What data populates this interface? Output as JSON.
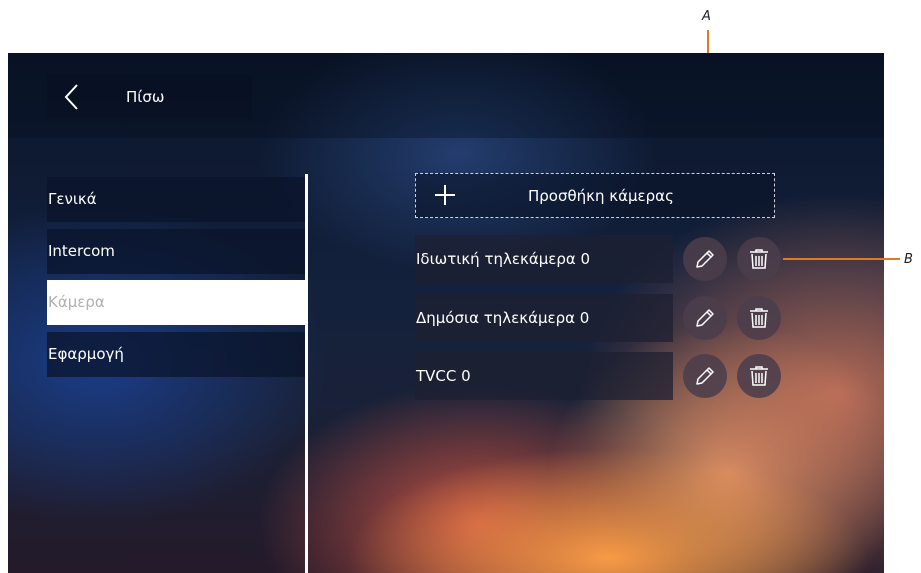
{
  "header": {
    "back_label": "Πίσω"
  },
  "sidebar": {
    "items": [
      {
        "label": "Γενικά",
        "active": false
      },
      {
        "label": "Intercom",
        "active": false
      },
      {
        "label": "Κάμερα",
        "active": true
      },
      {
        "label": "Εφαρμογή",
        "active": false
      }
    ]
  },
  "cameras": {
    "add_label": "Προσθήκη κάμερας",
    "items": [
      {
        "name": "Ιδιωτική τηλεκάμερα 0"
      },
      {
        "name": "Δημόσια τηλεκάμερα 0"
      },
      {
        "name": "TVCC 0"
      }
    ]
  },
  "callouts": {
    "a": "A",
    "b": "B"
  },
  "colors": {
    "callout_line": "#e07a23",
    "active_item_bg": "#ffffff",
    "active_item_text": "#b0b0b0"
  },
  "icons": {
    "edit": "pencil-icon",
    "delete": "trash-icon",
    "back": "chevron-left-icon",
    "add": "plus-icon"
  }
}
